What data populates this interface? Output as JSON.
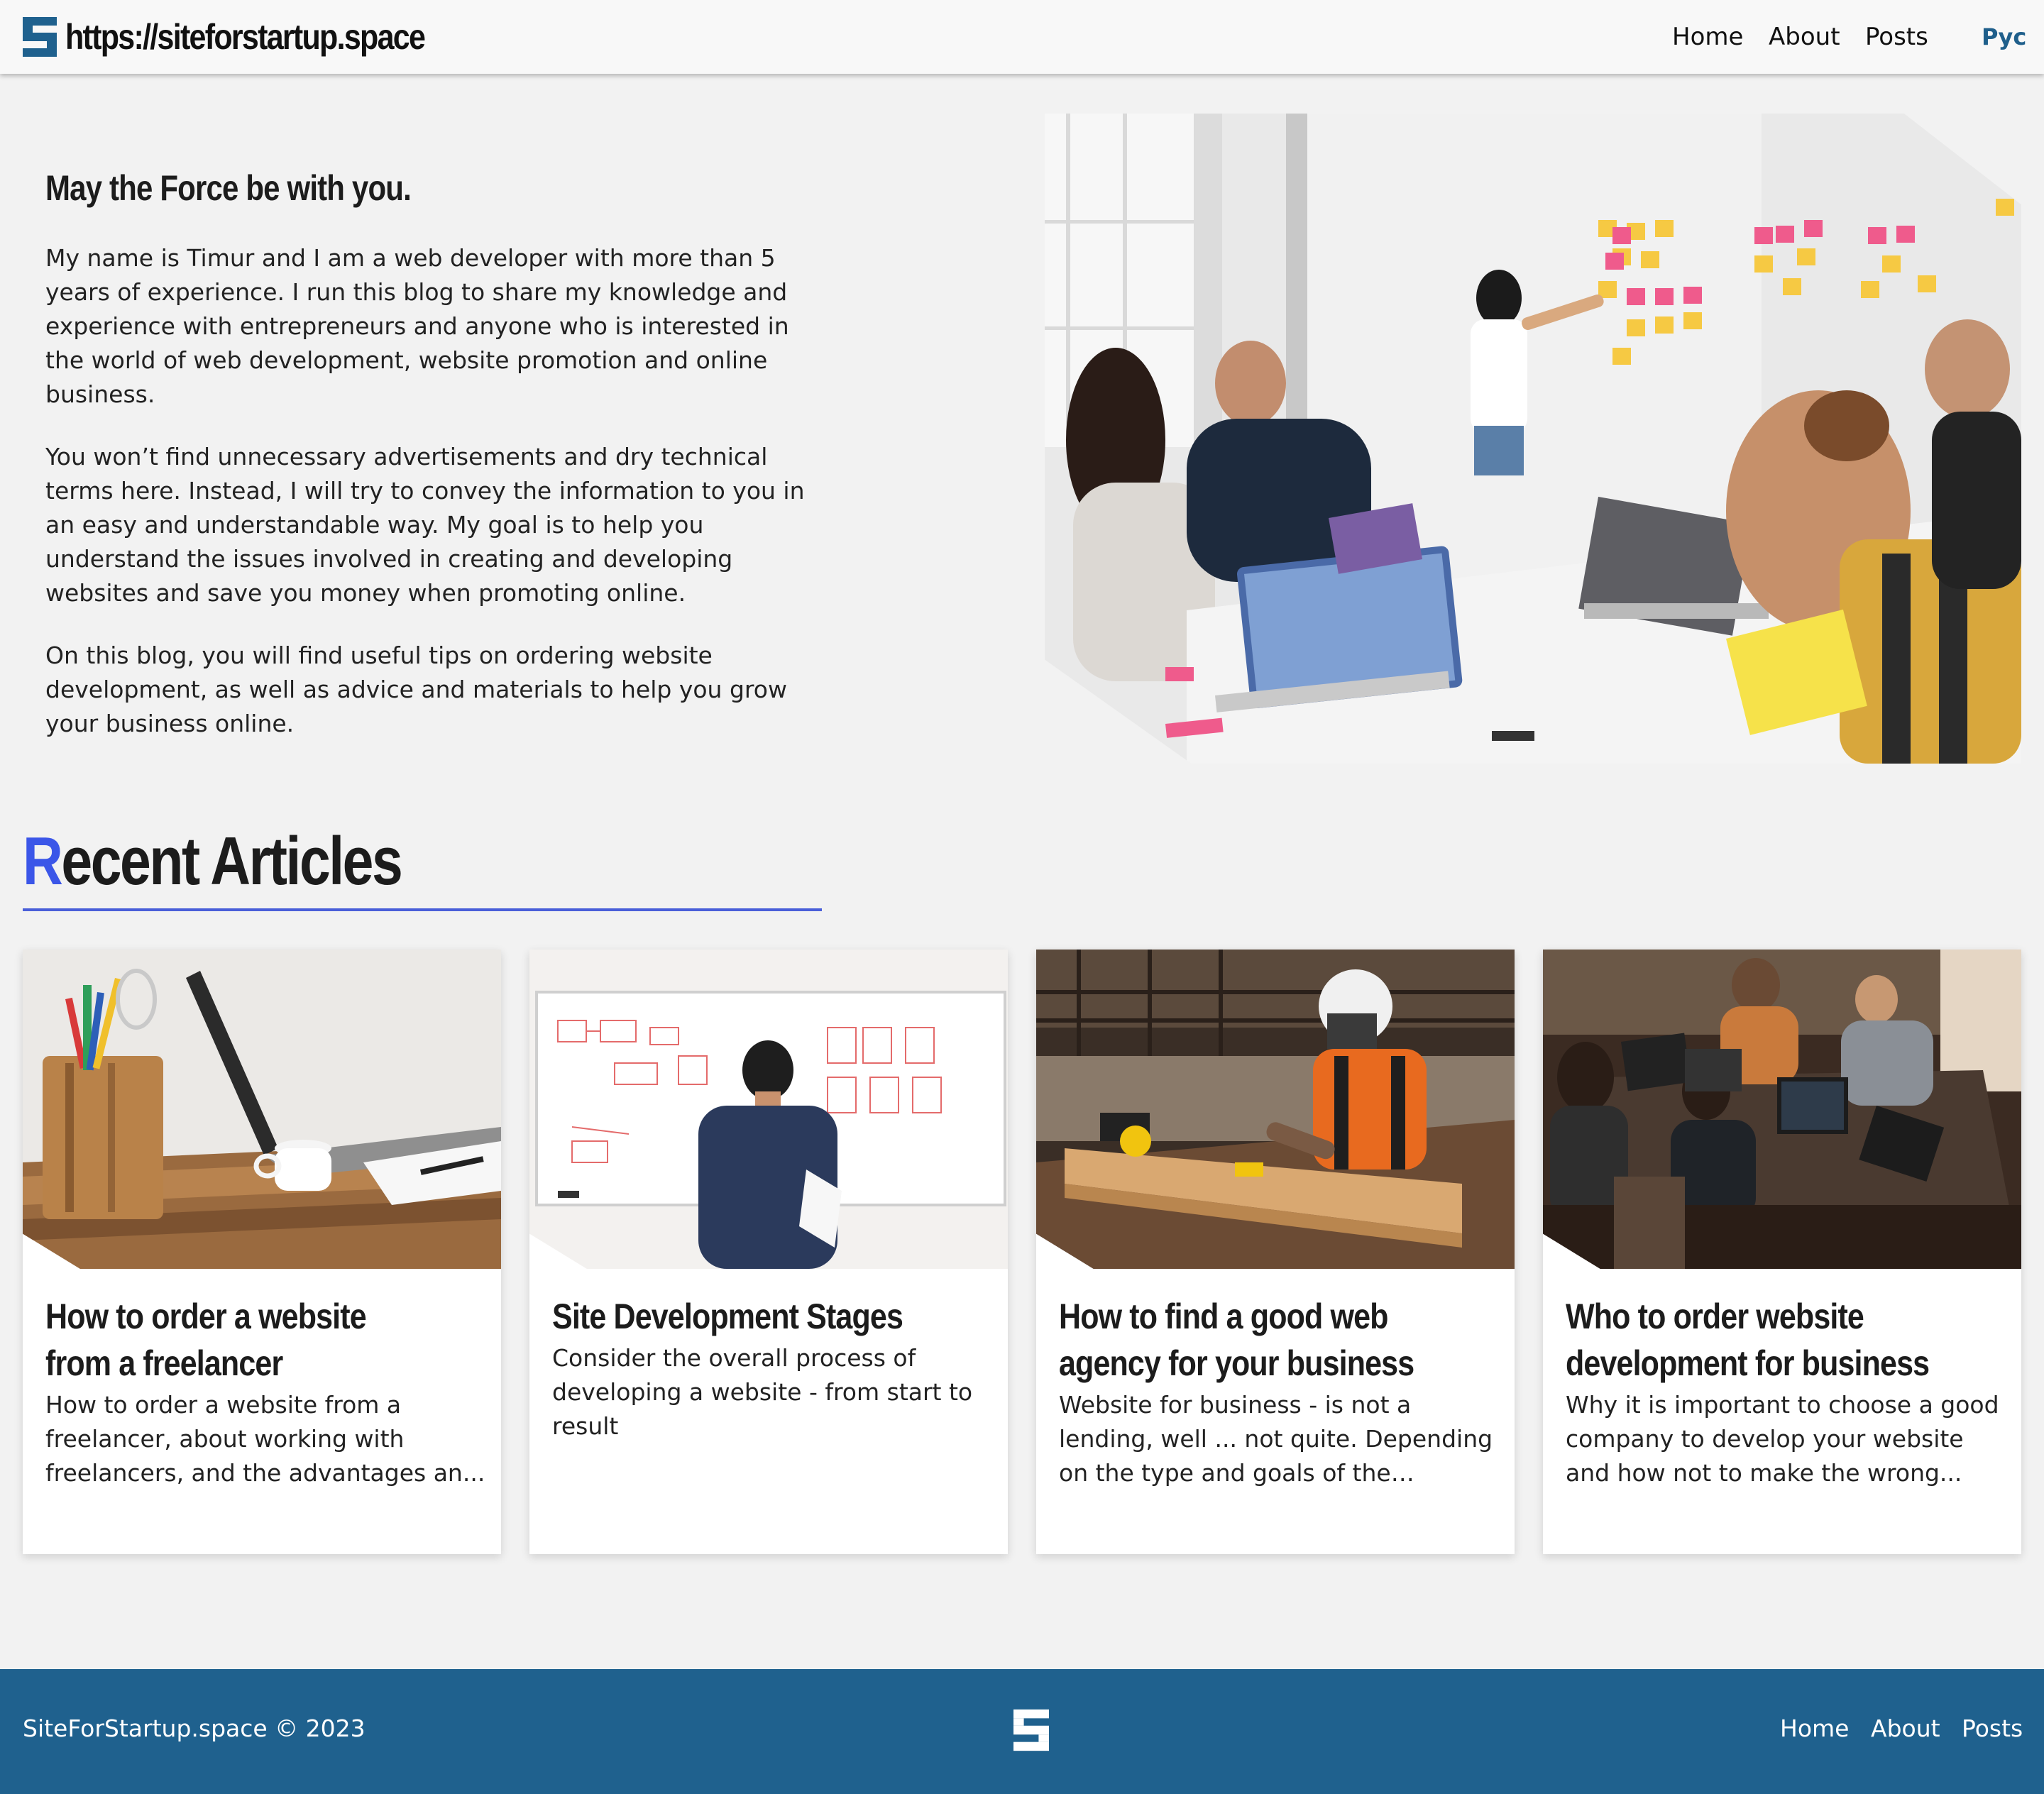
{
  "header": {
    "site_url": "https://siteforstartup.space",
    "nav": {
      "home": "Home",
      "about": "About",
      "posts": "Posts",
      "lang": "Рус"
    }
  },
  "intro": {
    "title": "May the Force be with you.",
    "paragraphs": [
      "My name is Timur and I am a web developer with more than 5 years of experience. I run this blog to share my knowledge and experience with entrepreneurs and anyone who is interested in the world of web development, website promotion and online business.",
      "You won’t find unnecessary advertisements and dry technical terms here. Instead, I will try to convey the information to you in an easy and understandable way. My goal is to help you understand the issues involved in creating and developing websites and save you money when promoting online.",
      "On this blog, you will find useful tips on ordering website development, as well as advice and materials to help you grow your business online."
    ]
  },
  "recent": {
    "title_first": "R",
    "title_rest": "ecent Articles",
    "cards": [
      {
        "title": "How to order a website from a freelancer",
        "desc": "How to order a website from a freelancer, about working with freelancers, and the advantages an..."
      },
      {
        "title": "Site Development Stages",
        "desc": "Consider the overall process of developing a website - from start to result"
      },
      {
        "title": "How to find a good web agency for your business",
        "desc": "Website for business - is not a lending, well ... not quite. Depending on the type and goals of the busines..."
      },
      {
        "title": "Who to order website development for business",
        "desc": "Why it is important to choose a good company to develop your website and how not to make the wrong..."
      }
    ]
  },
  "footer": {
    "copyright": "SiteForStartup.space © 2023",
    "nav": {
      "home": "Home",
      "about": "About",
      "posts": "Posts"
    }
  },
  "colors": {
    "brand_blue": "#1f618e",
    "accent_blue": "#3b56e8",
    "background": "#f2f2f2"
  },
  "icons": {
    "logo": "stacked-bars-logo-icon"
  }
}
